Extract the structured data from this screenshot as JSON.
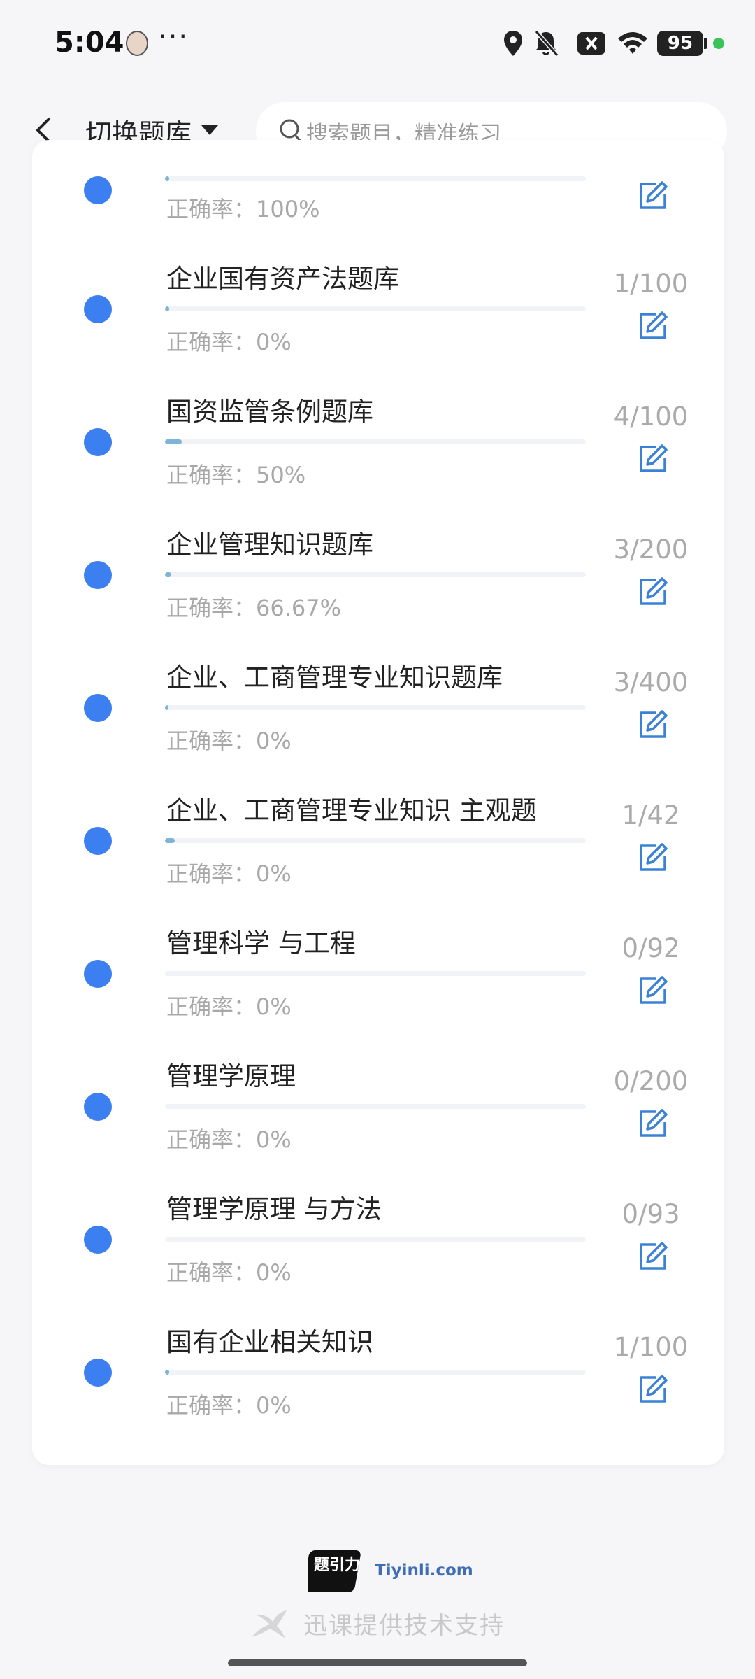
{
  "status_bar": {
    "time": "5:04",
    "dots": "···",
    "battery": "95",
    "icons": [
      "avatar",
      "location-icon",
      "mute-icon",
      "close-badge-icon",
      "wifi-icon",
      "battery-icon",
      "status-dot"
    ]
  },
  "nav": {
    "back_icon": "back-arrow-icon",
    "switch_label": "切换题库",
    "search_placeholder": "搜索题目，精准练习"
  },
  "accuracy_label": "正确率：",
  "items": [
    {
      "title": "",
      "accuracy": "100%",
      "count": "",
      "progress": 0.01
    },
    {
      "title": "企业国有资产法题库",
      "accuracy": "0%",
      "count": "1/100",
      "progress": 0.01
    },
    {
      "title": "国资监管条例题库",
      "accuracy": "50%",
      "count": "4/100",
      "progress": 0.04
    },
    {
      "title": "企业管理知识题库",
      "accuracy": "66.67%",
      "count": "3/200",
      "progress": 0.015
    },
    {
      "title": "企业、工商管理专业知识题库",
      "accuracy": "0%",
      "count": "3/400",
      "progress": 0.0075
    },
    {
      "title": "企业、工商管理专业知识 主观题",
      "accuracy": "0%",
      "count": "1/42",
      "progress": 0.024
    },
    {
      "title": "管理科学 与工程",
      "accuracy": "0%",
      "count": "0/92",
      "progress": 0
    },
    {
      "title": "管理学原理",
      "accuracy": "0%",
      "count": "0/200",
      "progress": 0
    },
    {
      "title": "管理学原理 与方法",
      "accuracy": "0%",
      "count": "0/93",
      "progress": 0
    },
    {
      "title": "国有企业相关知识",
      "accuracy": "0%",
      "count": "1/100",
      "progress": 0.01
    }
  ],
  "footer": {
    "logo_text": "题引力",
    "domain": "Tiyinli.com",
    "support": "迅课提供技术支持"
  },
  "colors": {
    "accent": "#3b7ff0",
    "progress_fill": "#7db4d8",
    "muted_text": "#a8a8a8",
    "edit_icon": "#3b82d6"
  }
}
